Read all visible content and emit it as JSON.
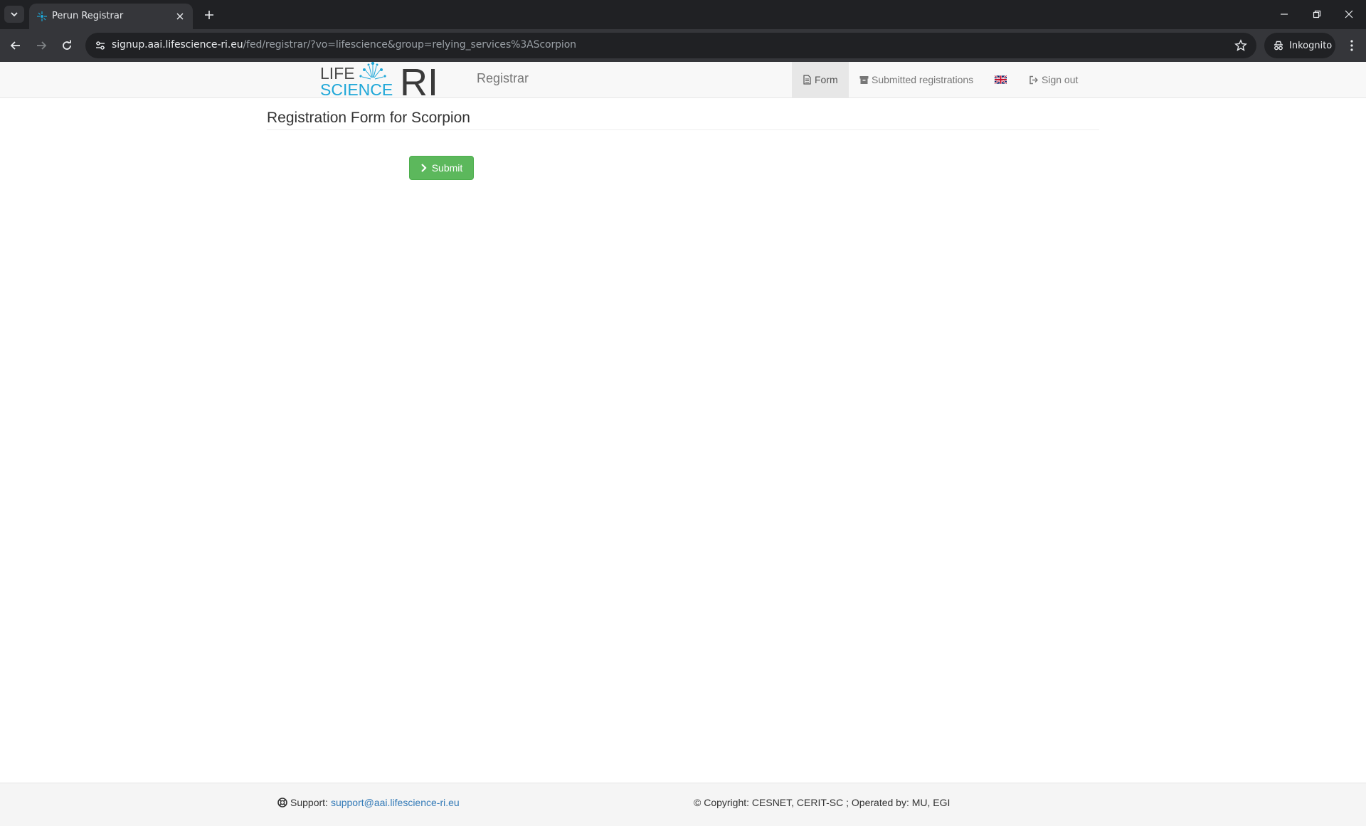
{
  "browser": {
    "tab_title": "Perun Registrar",
    "url_host": "signup.aai.lifescience-ri.eu",
    "url_path": "/fed/registrar/?vo=lifescience&group=relying_services%3AScorpion",
    "incognito_label": "Inkognito"
  },
  "navbar": {
    "logo_text_life": "LIFE",
    "logo_text_science": "SCIENCE",
    "logo_text_ri": "RI",
    "brand": "Registrar",
    "items": [
      {
        "label": "Form",
        "icon": "file-icon",
        "active": true
      },
      {
        "label": "Submitted registrations",
        "icon": "archive-icon"
      },
      {
        "label": "",
        "icon": "uk-flag-icon"
      },
      {
        "label": "Sign out",
        "icon": "logout-icon"
      }
    ]
  },
  "main": {
    "title": "Registration Form for Scorpion",
    "submit_label": "Submit"
  },
  "footer": {
    "support_label": "Support:",
    "support_email": "support@aai.lifescience-ri.eu",
    "copyright": "© Copyright: CESNET, CERIT-SC ; Operated by: MU, EGI"
  },
  "colors": {
    "submit_green": "#5cb85c",
    "logo_blue": "#1ea7d8",
    "link_blue": "#337ab7"
  }
}
